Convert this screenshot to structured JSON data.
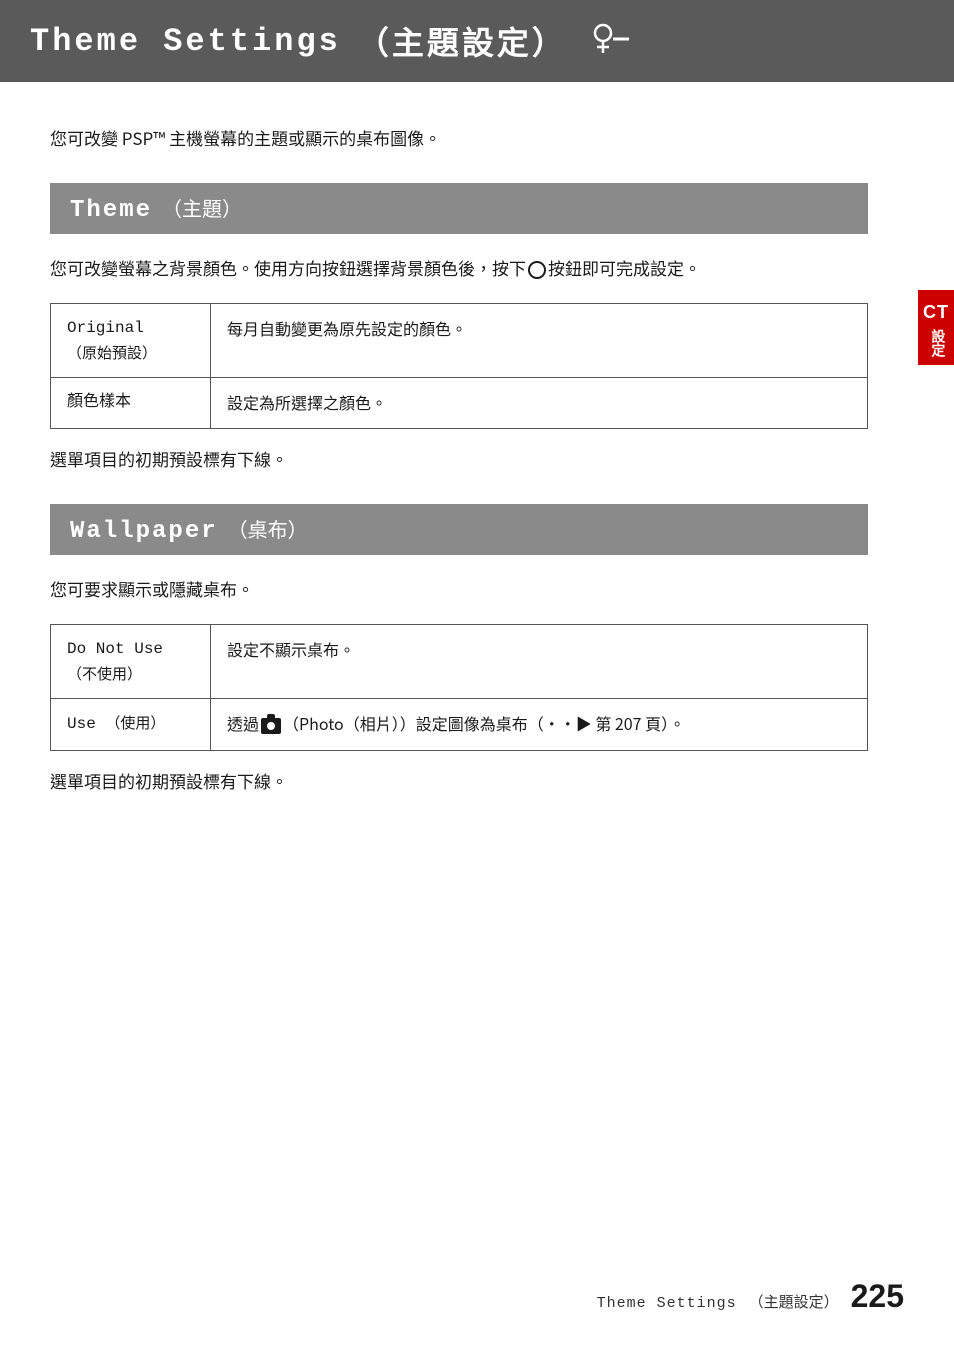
{
  "header": {
    "title_en": "Theme Settings",
    "title_zh": "（主題設定）",
    "icon": "key-icon"
  },
  "intro": {
    "text": "您可改變 PSP™ 主機螢幕的主題或顯示的桌布圖像。"
  },
  "theme_section": {
    "title_en": "Theme",
    "title_zh": "（主題）",
    "description": "您可改變螢幕之背景顏色。使用方向按鈕選擇背景顏色後，按下◎按鈕即可完成設定。",
    "options": [
      {
        "label_en": "Original",
        "label_zh": "（原始預設）",
        "description": "每月自動變更為原先設定的顏色。"
      },
      {
        "label_en": "顏色樣本",
        "label_zh": "",
        "description": "設定為所選擇之顏色。"
      }
    ],
    "note": "選單項目的初期預設標有下線。"
  },
  "wallpaper_section": {
    "title_en": "Wallpaper",
    "title_zh": "（桌布）",
    "description": "您可要求顯示或隱藏桌布。",
    "options": [
      {
        "label_en": "Do Not Use",
        "label_zh": "（不使用）",
        "description": "設定不顯示桌布。"
      },
      {
        "label_en": "Use",
        "label_zh": "（使用）",
        "description": "透過 (Photo（相片））設定圖像為桌布（••▶ 第 207 頁）。"
      }
    ],
    "note": "選單項目的初期預設標有下線。"
  },
  "side_tab": {
    "ct_label": "CT",
    "vertical_text": "設定"
  },
  "footer": {
    "text_en": "Theme Settings",
    "text_zh": "（主題設定）",
    "page_number": "225"
  }
}
